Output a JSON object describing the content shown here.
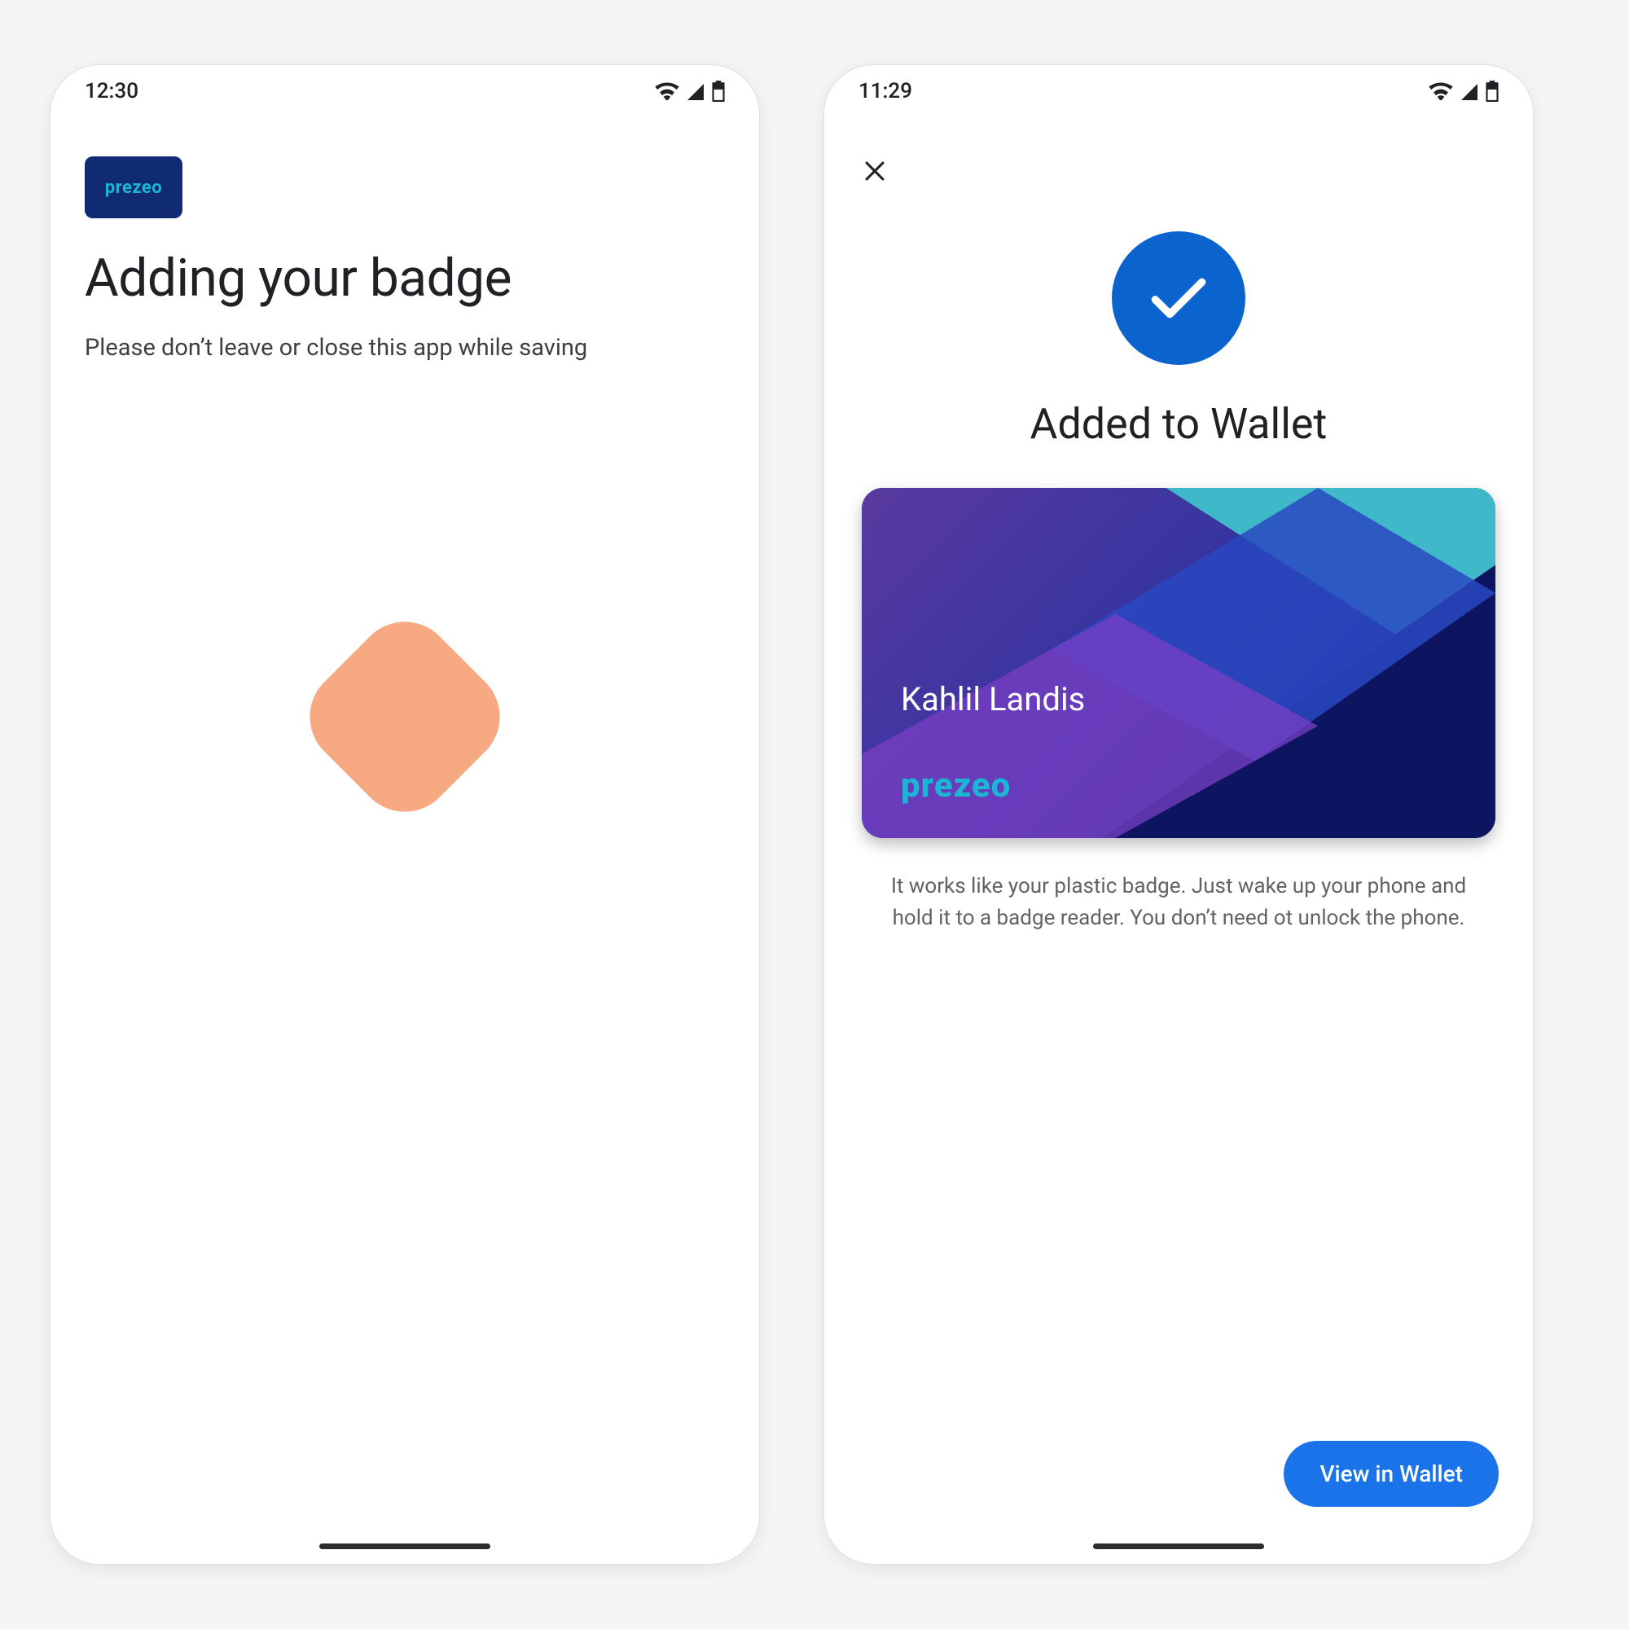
{
  "screen1": {
    "status_time": "12:30",
    "badge_brand": "prezeo",
    "title": "Adding your badge",
    "subtitle": "Please don’t leave or close this app while saving"
  },
  "screen2": {
    "status_time": "11:29",
    "close_label": "Close",
    "title": "Added to Wallet",
    "card_name": "Kahlil Landis",
    "card_brand": "prezeo",
    "description": "It works like your plastic badge. Just wake up your phone and hold it to a badge reader. You don’t need ot unlock the phone.",
    "cta_label": "View in Wallet"
  },
  "colors": {
    "primary_blue": "#1a73e8",
    "check_blue": "#0b63ce",
    "peach": "#f7a982",
    "badge_navy": "#102a73",
    "badge_cyan": "#1bb6d6"
  }
}
